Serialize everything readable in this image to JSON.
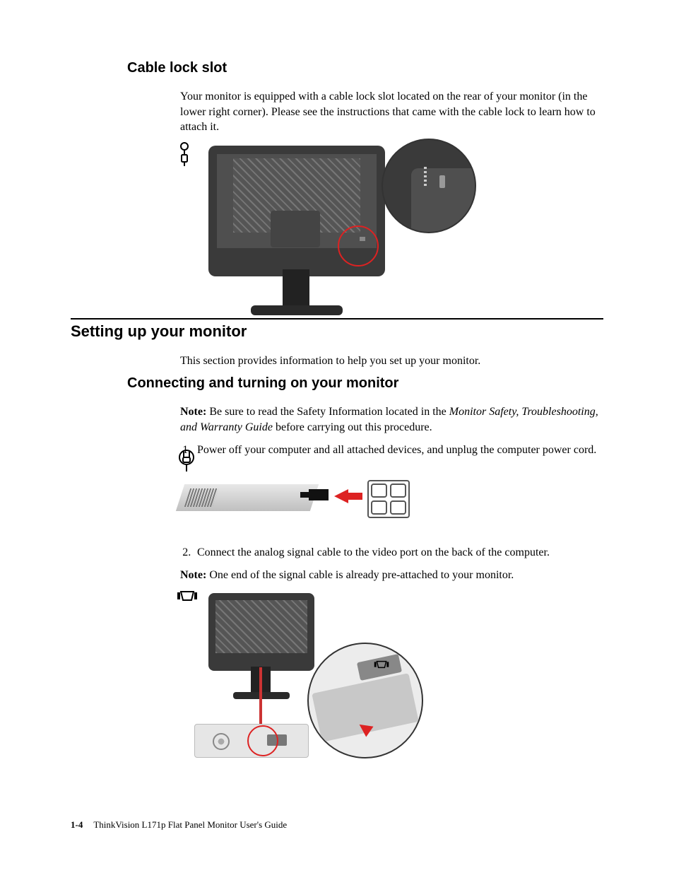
{
  "sec1": {
    "heading": "Cable lock slot",
    "p1": "Your monitor is equipped with a cable lock slot located on the rear of your monitor (in the lower right corner). Please see the instructions that came with the cable lock to learn how to attach it."
  },
  "sec2": {
    "heading": "Setting up your monitor",
    "p1": "This section provides information to help you set up your monitor."
  },
  "sec3": {
    "heading": "Connecting and turning on your monitor",
    "note_label": "Note:",
    "note1_pre": "Be sure to read the Safety Information located in the ",
    "note1_ital": "Monitor Safety, Troubleshooting, and Warranty Guide",
    "note1_post": " before carrying out this procedure.",
    "step1": "Power off your computer and all attached devices, and unplug the computer power cord.",
    "step2": "Connect the analog signal cable to the video port on the back of the computer.",
    "note2": "One end of the signal cable is already pre-attached to your monitor."
  },
  "footer": {
    "page": "1-4",
    "title": "ThinkVision L171p Flat Panel Monitor User's Guide"
  }
}
